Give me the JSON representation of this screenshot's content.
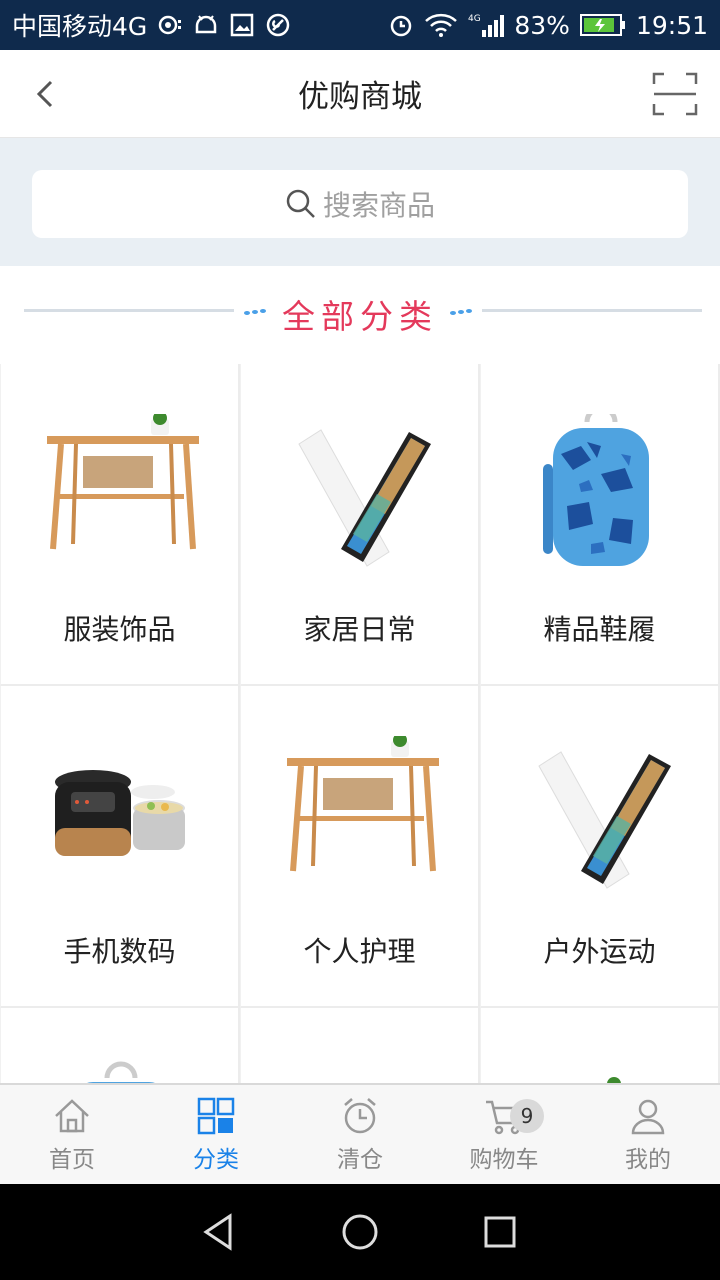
{
  "status_bar": {
    "carrier": "中国移动4G",
    "network_type": "4G",
    "battery": "83%",
    "time": "19:51",
    "icons": [
      "target-icon",
      "android-icon",
      "image-icon",
      "settings-icon",
      "alarm-icon",
      "wifi-icon",
      "signal-icon",
      "battery-icon"
    ]
  },
  "header": {
    "title": "优购商城",
    "back_icon": "chevron-left-icon",
    "scan_icon": "scan-icon"
  },
  "search": {
    "placeholder": "搜索商品",
    "icon": "search-icon"
  },
  "section": {
    "title": "全部分类"
  },
  "categories": [
    {
      "label": "服装饰品",
      "image": "wooden-table"
    },
    {
      "label": "家居日常",
      "image": "smartphone"
    },
    {
      "label": "精品鞋履",
      "image": "camo-backpack"
    },
    {
      "label": "手机数码",
      "image": "rice-cooker"
    },
    {
      "label": "个人护理",
      "image": "wooden-table"
    },
    {
      "label": "户外运动",
      "image": "smartphone"
    },
    {
      "label": "",
      "image": "backpack-partial"
    },
    {
      "label": "",
      "image": "empty"
    },
    {
      "label": "",
      "image": "plant-partial"
    }
  ],
  "bottom_nav": {
    "items": [
      {
        "label": "首页",
        "icon": "home-icon",
        "active": false
      },
      {
        "label": "分类",
        "icon": "grid-icon",
        "active": true
      },
      {
        "label": "清仓",
        "icon": "alarm-clock-icon",
        "active": false
      },
      {
        "label": "购物车",
        "icon": "cart-icon",
        "active": false,
        "badge": "9"
      },
      {
        "label": "我的",
        "icon": "user-icon",
        "active": false
      }
    ]
  },
  "system_nav": [
    "back-triangle-icon",
    "home-circle-icon",
    "recents-square-icon"
  ],
  "colors": {
    "status_bar_bg": "#0f2a4c",
    "accent": "#1a82e8",
    "section_title": "#e4395b",
    "search_bg": "#e9eff4"
  }
}
